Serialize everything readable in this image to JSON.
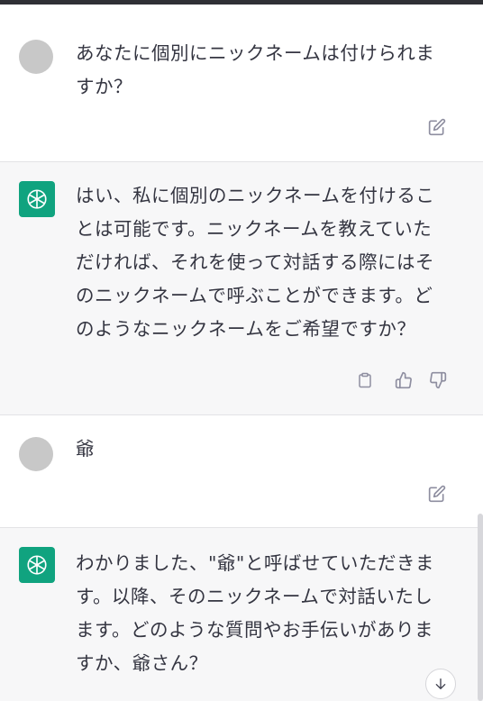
{
  "conversation": [
    {
      "role": "user",
      "text": "あなたに個別にニックネームは付けられますか？"
    },
    {
      "role": "assistant",
      "text": "はい、私に個別のニックネームを付けることは可能です。ニックネームを教えていただければ、それを使って対話する際にはそのニックネームで呼ぶことができます。どのようなニックネームをご希望ですか？"
    },
    {
      "role": "user",
      "text": "爺"
    },
    {
      "role": "assistant",
      "text": "わかりました、\"爺\"と呼ばせていただきます。以降、そのニックネームで対話いたします。どのような質問やお手伝いがありますか、爺さん？"
    }
  ],
  "icons": {
    "user_avatar": "user-avatar",
    "assistant_avatar": "openai-logo-icon",
    "edit": "edit-icon",
    "copy": "clipboard-icon",
    "thumbs_up": "thumbs-up-icon",
    "thumbs_down": "thumbs-down-icon",
    "scroll_down": "arrow-down-icon"
  },
  "colors": {
    "assistant_bg": "#f7f7f8",
    "user_bg": "#ffffff",
    "brand": "#10a37f",
    "text": "#343541",
    "icon": "#8e8ea0"
  }
}
